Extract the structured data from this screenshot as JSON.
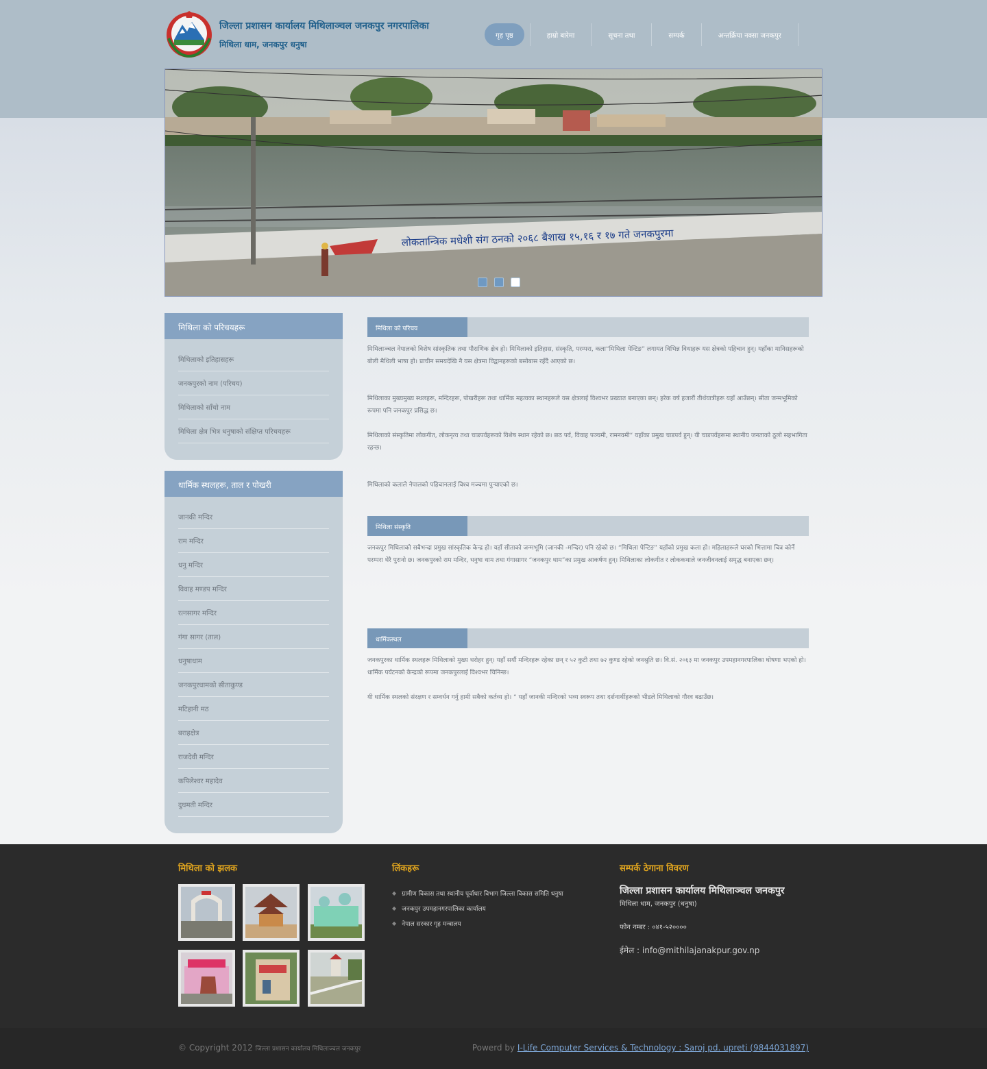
{
  "header": {
    "title": "जिल्ला प्रशासन कार्यालय मिथिलाञ्चल जनकपुर नगरपालिका",
    "subtitle": "मिथिला धाम, जनकपुर धनुषा"
  },
  "nav": {
    "items": [
      "गृह पृष्ठ",
      "हाम्रो बारेमा",
      "सूचना तथा",
      "सम्पर्क",
      "अन्तर्क्रिया नक्सा जनकपुर"
    ]
  },
  "banner": {
    "mural_text": "लोकतान्त्रिक मधेशी संग ठनको २०६८ बैशाख १५,१६ र १७ गते जनकपुरमा",
    "slides": 3,
    "active_slide": 3
  },
  "sidebar": {
    "box1": {
      "title": "मिथिला को परिचयहरू",
      "items": [
        "मिथिलाको इतिहासहरू",
        "जनकपुरको नाम (परिचय)",
        "मिथिलाको साँचो नाम",
        "मिथिला क्षेत्र भित्र धनुषाको संक्षिप्त परिचयहरू"
      ]
    },
    "box2": {
      "title": "धार्मिक स्थलहरू, ताल र पोखरी",
      "items": [
        "जानकी मन्दिर",
        "राम मन्दिर",
        "धनु मन्दिर",
        "विवाह मण्डप मन्दिर",
        "रत्नसागर मन्दिर",
        "गंगा सागर (ताल)",
        "धनुषाधाम",
        "जनकपुरधामको सीताकुण्ड",
        "मटिहानी मठ",
        "बराहक्षेत्र",
        "राजदेवी मन्दिर",
        "कपिलेश्वर महादेव",
        "दुधमती मन्दिर"
      ]
    }
  },
  "sections": [
    {
      "title": "मिथिला को परिचय",
      "paragraphs": [
        "मिथिलाञ्चल नेपालको विशेष सांस्कृतिक तथा पौराणिक क्षेत्र हो। मिथिलाको इतिहास, संस्कृति, परम्परा, कला“मिथिला पेन्टिङ” लगायत विभिन्न विधाहरू यस क्षेत्रको पहिचान हुन्। यहाँका मानिसहरूको बोली मैथिली भाषा हो। प्राचीन समयदेखि नै यस क्षेत्रमा विद्वानहरूको बसोबास रहँदै आएको छ।",
        "मिथिलाका मुख्यमुख्य स्थलहरू, मन्दिरहरू, पोखरीहरू तथा धार्मिक महत्वका स्थानहरूले यस क्षेत्रलाई विश्वभर प्रख्यात बनाएका छन्। हरेक वर्ष हजारौं तीर्थयात्रीहरू यहाँ आउँछन्। सीता जन्मभूमिको रूपमा पनि जनकपुर प्रसिद्ध छ।",
        "मिथिलाको संस्कृतिमा लोकगीत, लोकनृत्य तथा चाडपर्वहरूको विशेष स्थान रहेको छ। छठ पर्व, विवाह पञ्चमी, रामनवमी“ यहाँका प्रमुख चाडपर्व हुन्। यी चाडपर्वहरूमा स्थानीय जनताको ठूलो सहभागिता रहन्छ।",
        "मिथिलाको कलाले नेपालको पहिचानलाई विश्व मञ्चमा पुर्‍याएको छ।"
      ]
    },
    {
      "title": "मिथिला संस्कृति",
      "paragraphs": [
        "जनकपुर मिथिलाको सबैभन्दा प्रमुख सांस्कृतिक केन्द्र हो। यहाँ सीताको जन्मभूमि (जानकी -मन्दिर) पनि रहेको छ। “मिथिला पेन्टिङ” यहाँको प्रमुख कला हो। महिलाहरूले घरको भित्तामा चित्र कोर्ने परम्परा धेरै पुरानो छ। जनकपुरको राम मन्दिर, धनुषा धाम तथा गंगासागर “जनकपुर धाम”का प्रमुख आकर्षण हुन्। मिथिलाका लोकगीत र लोककथाले जनजीवनलाई समृद्ध बनाएका छन्।"
      ]
    },
    {
      "title": "धार्मिकस्थल",
      "paragraphs": [
        "जनकपुरका धार्मिक स्थलहरू मिथिलाको मुख्य धरोहर हुन्। यहाँ सयौं मन्दिरहरू रहेका छन् र ५२ कुटी तथा ७२ कुण्ड रहेको जनश्रुति छ। वि.सं. २०६३ मा जनकपुर उपमहानगरपालिका घोषणा भएको हो। धार्मिक पर्यटनको केन्द्रको रूपमा जनकपुरलाई विश्वभर चिनिन्छ।",
        "यी धार्मिक स्थलको संरक्षण र सम्वर्धन गर्नु हामी सबैको कर्तव्य हो। “ यहाँ जानकी मन्दिरको भव्य स्वरूप तथा दर्शनार्थीहरूको भीडले मिथिलाको गौरव बढाउँछ।"
      ]
    }
  ],
  "footer": {
    "gallery_title": "मिथिला को झलक",
    "links_title": "लिंकहरू",
    "links": [
      "ग्रामीण विकास तथा स्थानीय पूर्वाधार विभाग जिल्ला विकास समिति धनुषा",
      "जनकपुर उपमहानगरपालिका कार्यालय",
      "नेपाल सरकार गृह मन्त्रालय"
    ],
    "contact_title": "सम्पर्क ठेगाना विवरण",
    "contact_org": "जिल्ला प्रशासन कार्यालय मिथिलाञ्चल जनकपुर",
    "contact_address": "मिथिला धाम, जनकपुर (धनुषा)",
    "contact_phone": "फोन नम्बर : ०४१-५२००००",
    "contact_email": "ईमेल : info@mithilajanakpur.gov.np",
    "copyright_prefix": "© Copyright 2012",
    "copyright_org": "जिल्ला प्रशासन कार्यालय मिथिलाञ्चल जनकपुर",
    "powered_prefix": "Powerd by",
    "powered_link": "I-Life Computer Services & Technology : Saroj pd. upreti (9844031897)"
  }
}
